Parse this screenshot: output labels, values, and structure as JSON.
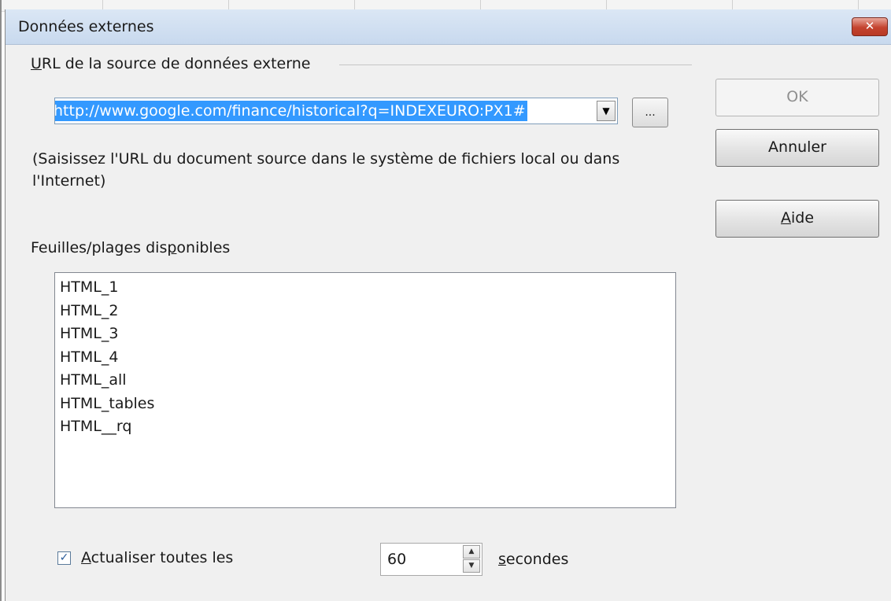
{
  "window": {
    "title": "Données externes",
    "close_label": "✕"
  },
  "url_section": {
    "label_underlined": "U",
    "label_rest": "RL de la source de données externe",
    "value": "http://www.google.com/finance/historical?q=INDEXEURO:PX1#",
    "browse_label": "...",
    "hint": "(Saisissez l'URL du document source dans le système de fichiers local ou dans l'Internet)"
  },
  "ranges": {
    "label_before": "Feuilles/plages dis",
    "label_underlined": "p",
    "label_after": "onibles",
    "items": [
      "HTML_1",
      "HTML_2",
      "HTML_3",
      "HTML_4",
      "HTML_all",
      "HTML_tables",
      "HTML__rq"
    ]
  },
  "refresh": {
    "checked": true,
    "check_mark": "✓",
    "label_underlined": "A",
    "label_rest": "ctualiser toutes les",
    "value": "60",
    "unit_underlined": "s",
    "unit_rest": "econdes"
  },
  "buttons": {
    "ok": "OK",
    "cancel": "Annuler",
    "help_underlined": "A",
    "help_rest": "ide"
  },
  "colors": {
    "selection": "#3399ff",
    "dialog_bg": "#f0f0f0",
    "close_button": "#c4432f"
  }
}
